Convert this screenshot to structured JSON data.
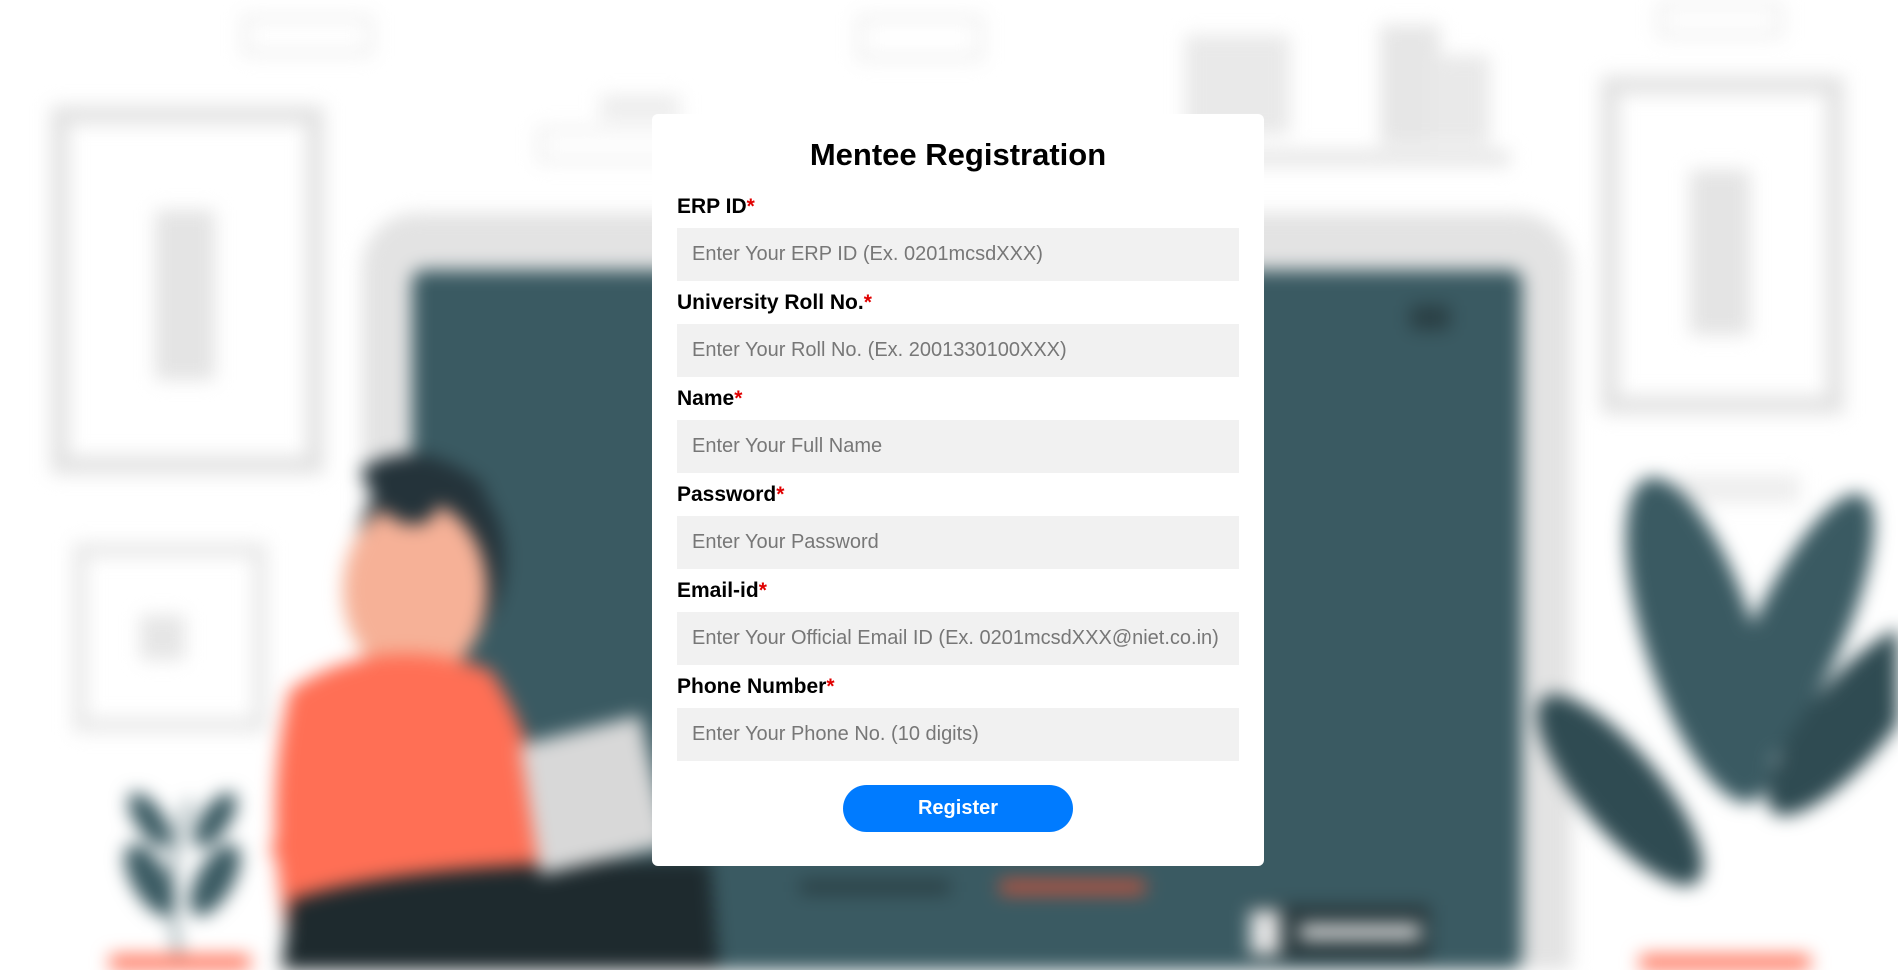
{
  "form": {
    "title": "Mentee Registration",
    "required_mark": "*",
    "fields": [
      {
        "label": "ERP ID",
        "placeholder": "Enter Your ERP ID (Ex. 0201mcsdXXX)",
        "value": ""
      },
      {
        "label": "University Roll No.",
        "placeholder": "Enter Your Roll No. (Ex. 2001330100XXX)",
        "value": ""
      },
      {
        "label": "Name",
        "placeholder": "Enter Your Full Name",
        "value": ""
      },
      {
        "label": "Password",
        "placeholder": "Enter Your Password",
        "value": ""
      },
      {
        "label": "Email-id",
        "placeholder": "Enter Your Official Email ID (Ex. 0201mcsdXXX@niet.co.in)",
        "value": ""
      },
      {
        "label": "Phone Number",
        "placeholder": "Enter Your Phone No. (10 digits)",
        "value": ""
      }
    ],
    "submit_label": "Register"
  },
  "colors": {
    "accent": "#007bff",
    "required": "#e00000",
    "input_bg": "#f1f1f1",
    "illustration_teal": "#3a5a62",
    "illustration_coral": "#ff6f55"
  },
  "background": {
    "illustration": "blurred-woman-with-laptop-illustration"
  }
}
